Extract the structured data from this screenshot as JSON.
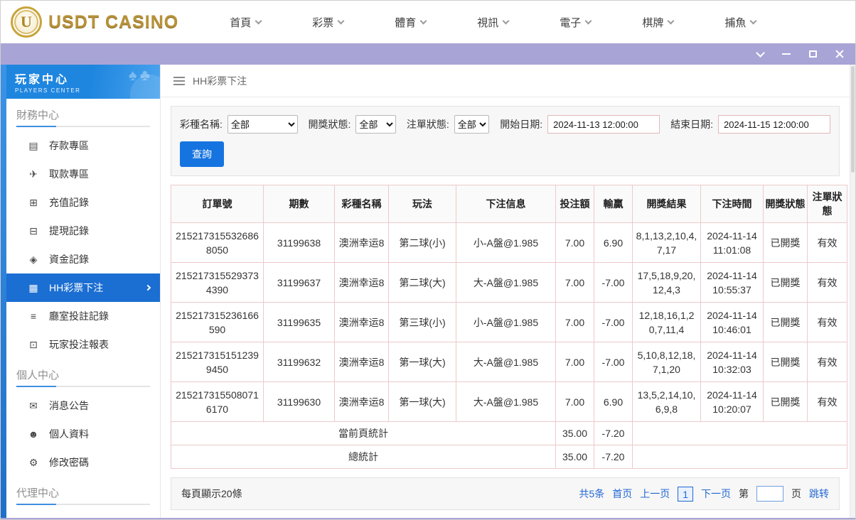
{
  "header": {
    "logo": {
      "badge_letter": "U",
      "text": "USDT CASINO"
    },
    "nav": [
      {
        "label": "首頁"
      },
      {
        "label": "彩票"
      },
      {
        "label": "體育"
      },
      {
        "label": "視訊"
      },
      {
        "label": "電子"
      },
      {
        "label": "棋牌"
      },
      {
        "label": "捕魚"
      }
    ]
  },
  "sidebar": {
    "title": "玩家中心",
    "subtitle": "PLAYERS CENTER",
    "sections": [
      {
        "title": "財務中心",
        "items": [
          {
            "label": "存款專區",
            "icon": "deposit-icon",
            "active": false
          },
          {
            "label": "取款專區",
            "icon": "withdraw-icon",
            "active": false
          },
          {
            "label": "充值記錄",
            "icon": "recharge-record-icon",
            "active": false
          },
          {
            "label": "提現記錄",
            "icon": "cashout-record-icon",
            "active": false
          },
          {
            "label": "資金記錄",
            "icon": "funds-record-icon",
            "active": false
          },
          {
            "label": "HH彩票下注",
            "icon": "lottery-bet-icon",
            "active": true
          },
          {
            "label": "廳室投註記錄",
            "icon": "hall-record-icon",
            "active": false
          },
          {
            "label": "玩家投注報表",
            "icon": "report-icon",
            "active": false
          }
        ]
      },
      {
        "title": "個人中心",
        "items": [
          {
            "label": "消息公告",
            "icon": "bell-icon",
            "active": false
          },
          {
            "label": "個人資料",
            "icon": "profile-icon",
            "active": false
          },
          {
            "label": "修改密碼",
            "icon": "password-icon",
            "active": false
          }
        ]
      },
      {
        "title": "代理中心",
        "items": []
      }
    ]
  },
  "breadcrumb": {
    "title": "HH彩票下注"
  },
  "filters": {
    "lottery_label": "彩種名稱:",
    "lottery_value": "全部",
    "draw_status_label": "開獎狀態:",
    "draw_status_value": "全部",
    "order_status_label": "注單狀態:",
    "order_status_value": "全部",
    "start_label": "開始日期:",
    "start_value": "2024-11-13 12:00:00",
    "end_label": "結束日期:",
    "end_value": "2024-11-15 12:00:00",
    "search_button": "查詢"
  },
  "table": {
    "headers": [
      "訂單號",
      "期數",
      "彩種名稱",
      "玩法",
      "下注信息",
      "投注額",
      "輸贏",
      "開獎結果",
      "下注時間",
      "開獎狀態",
      "注單狀態"
    ],
    "rows": [
      [
        "2152173155326868050",
        "31199638",
        "澳洲幸运8",
        "第二球(小)",
        "小-A盤@1.985",
        "7.00",
        "6.90",
        "8,1,13,2,10,4,7,17",
        "2024-11-14 11:01:08",
        "已開獎",
        "有效"
      ],
      [
        "2152173155293734390",
        "31199637",
        "澳洲幸运8",
        "第二球(大)",
        "大-A盤@1.985",
        "7.00",
        "-7.00",
        "17,5,18,9,20,12,4,3",
        "2024-11-14 10:55:37",
        "已開獎",
        "有效"
      ],
      [
        "215217315236166590",
        "31199635",
        "澳洲幸运8",
        "第三球(小)",
        "小-A盤@1.985",
        "7.00",
        "-7.00",
        "12,18,16,1,20,7,11,4",
        "2024-11-14 10:46:01",
        "已開獎",
        "有效"
      ],
      [
        "2152173151512399450",
        "31199632",
        "澳洲幸运8",
        "第一球(大)",
        "大-A盤@1.985",
        "7.00",
        "-7.00",
        "5,10,8,12,18,7,1,20",
        "2024-11-14 10:32:03",
        "已開獎",
        "有效"
      ],
      [
        "2152173155080716170",
        "31199630",
        "澳洲幸运8",
        "第一球(大)",
        "大-A盤@1.985",
        "7.00",
        "6.90",
        "13,5,2,14,10,6,9,8",
        "2024-11-14 10:20:07",
        "已開獎",
        "有效"
      ]
    ],
    "page_summary_label": "當前頁統計",
    "page_summary": {
      "bet": "35.00",
      "winloss": "-7.20"
    },
    "total_summary_label": "總統計",
    "total_summary": {
      "bet": "35.00",
      "winloss": "-7.20"
    }
  },
  "pagination": {
    "per_page": "每頁顯示20條",
    "total": "共5条",
    "first": "首页",
    "prev": "上一页",
    "current": "1",
    "next": "下一页",
    "page_prefix": "第",
    "page_suffix": "页",
    "jump": "跳转"
  },
  "colors": {
    "titlebar_purple": "#a9a4d6",
    "sidebar_active_blue": "#1b6ed2",
    "accent_blue": "#1674e0",
    "link_blue": "#2468d4",
    "table_border_pink": "#eccaca",
    "logo_gold": "#b8923a"
  }
}
